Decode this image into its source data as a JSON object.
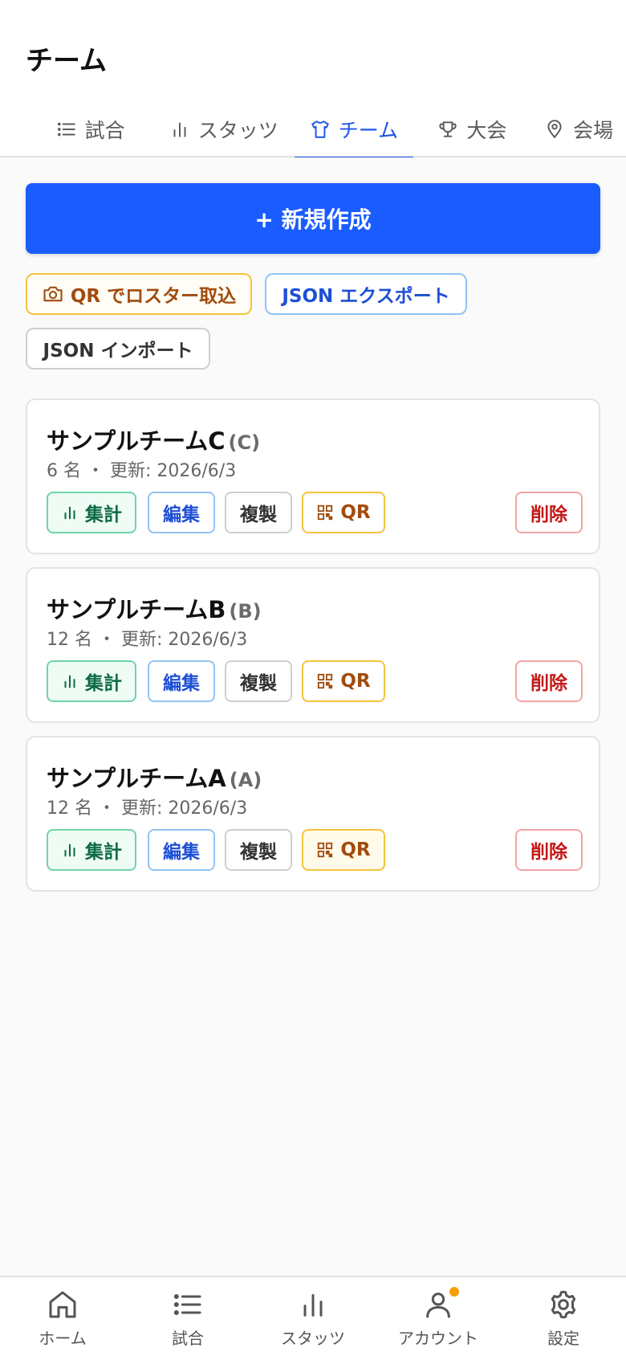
{
  "header": {
    "title": "チーム"
  },
  "tabs": [
    {
      "label": "試合",
      "icon": "list-icon"
    },
    {
      "label": "スタッツ",
      "icon": "bar-chart-icon"
    },
    {
      "label": "チーム",
      "icon": "shirt-icon",
      "active": true
    },
    {
      "label": "大会",
      "icon": "trophy-icon"
    },
    {
      "label": "会場",
      "icon": "map-pin-icon"
    }
  ],
  "toolbar": {
    "create_label": "+ 新規作成",
    "qr_import_label": "QR でロスター取込",
    "json_export_label": "JSON エクスポート",
    "json_import_label": "JSON インポート"
  },
  "teams": [
    {
      "name": "サンプルチームC",
      "code": "(C)",
      "meta": "6 名 ・ 更新: 2026/6/3"
    },
    {
      "name": "サンプルチームB",
      "code": "(B)",
      "meta": "12 名 ・ 更新: 2026/6/3"
    },
    {
      "name": "サンプルチームA",
      "code": "(A)",
      "meta": "12 名 ・ 更新: 2026/6/3"
    }
  ],
  "card_actions": {
    "stats": "集計",
    "edit": "編集",
    "copy": "複製",
    "qr": "QR",
    "delete": "削除"
  },
  "bottom_nav": [
    {
      "label": "ホーム",
      "icon": "home-icon"
    },
    {
      "label": "試合",
      "icon": "list-icon"
    },
    {
      "label": "スタッツ",
      "icon": "bar-chart-icon"
    },
    {
      "label": "アカウント",
      "icon": "user-icon",
      "badge": true
    },
    {
      "label": "設定",
      "icon": "gear-icon"
    }
  ],
  "colors": {
    "primary": "#1a5cff",
    "accent_blue": "#1d56e8",
    "stats_green": "#0d6a45",
    "qr_orange": "#a14b0c",
    "delete_red": "#c41818",
    "badge_orange": "#f59e0b"
  }
}
